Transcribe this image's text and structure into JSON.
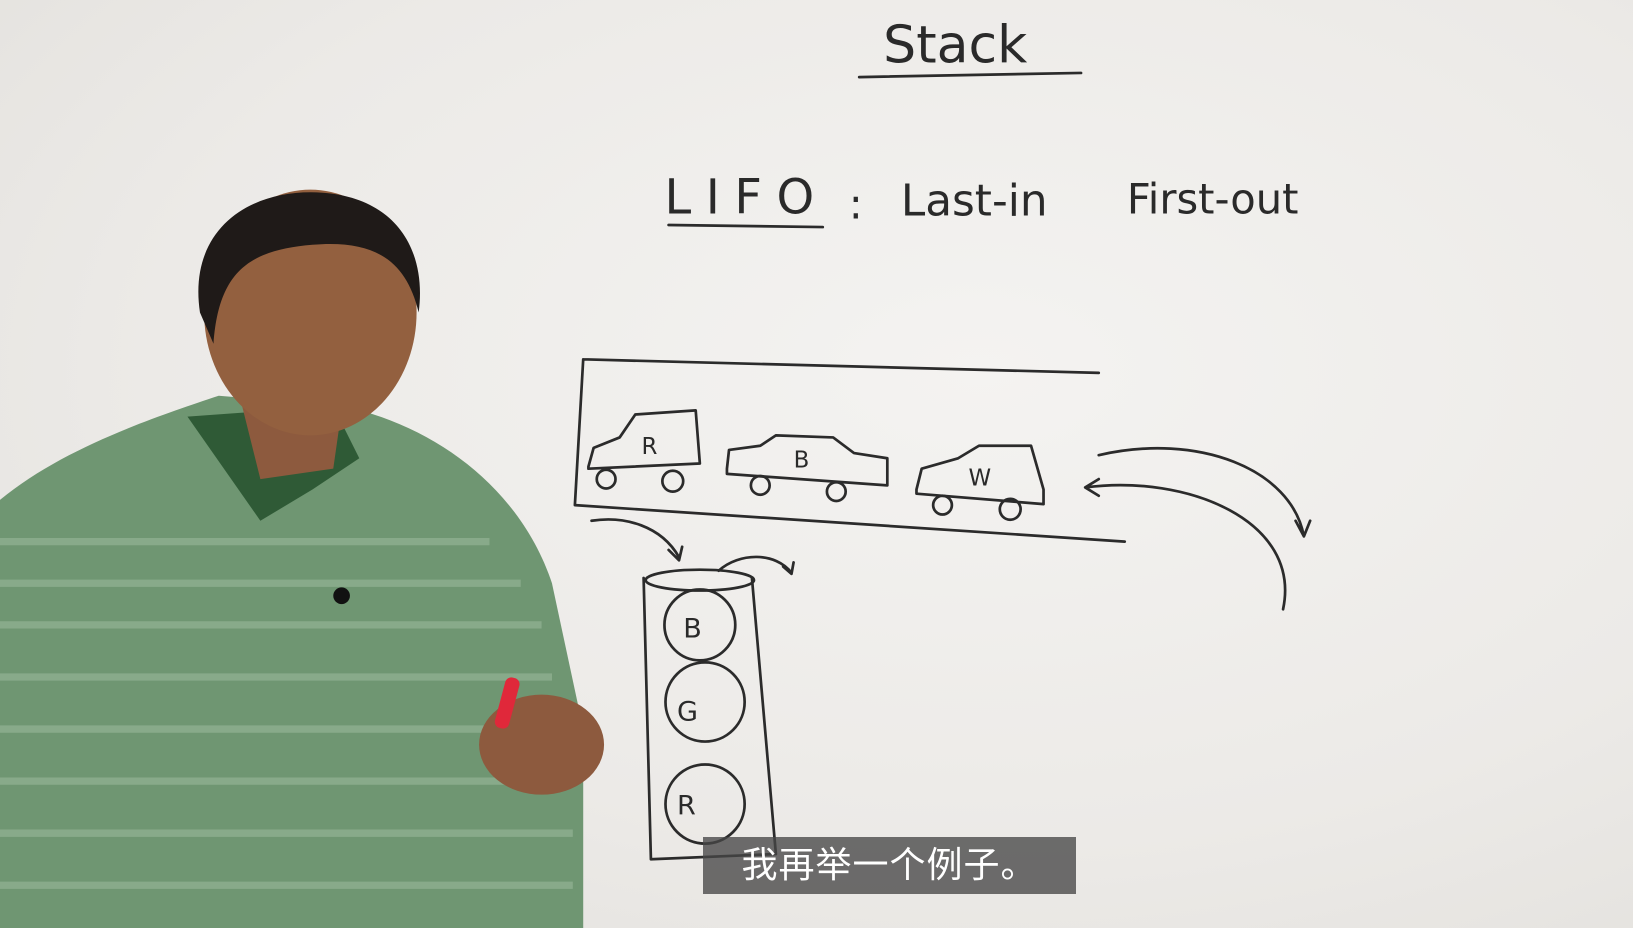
{
  "board": {
    "title": "Stack",
    "lifo": "LIFO",
    "colon": ":",
    "definition_1": "Last-in",
    "definition_2": "First-out",
    "cars": [
      "R",
      "B",
      "W"
    ],
    "balls": [
      "B",
      "G",
      "R"
    ]
  },
  "subtitle": "我再举一个例子。",
  "colors": {
    "shirt": "#5f8a63",
    "marker_red": "#e0283a",
    "subtitle_bg": "#464646"
  }
}
